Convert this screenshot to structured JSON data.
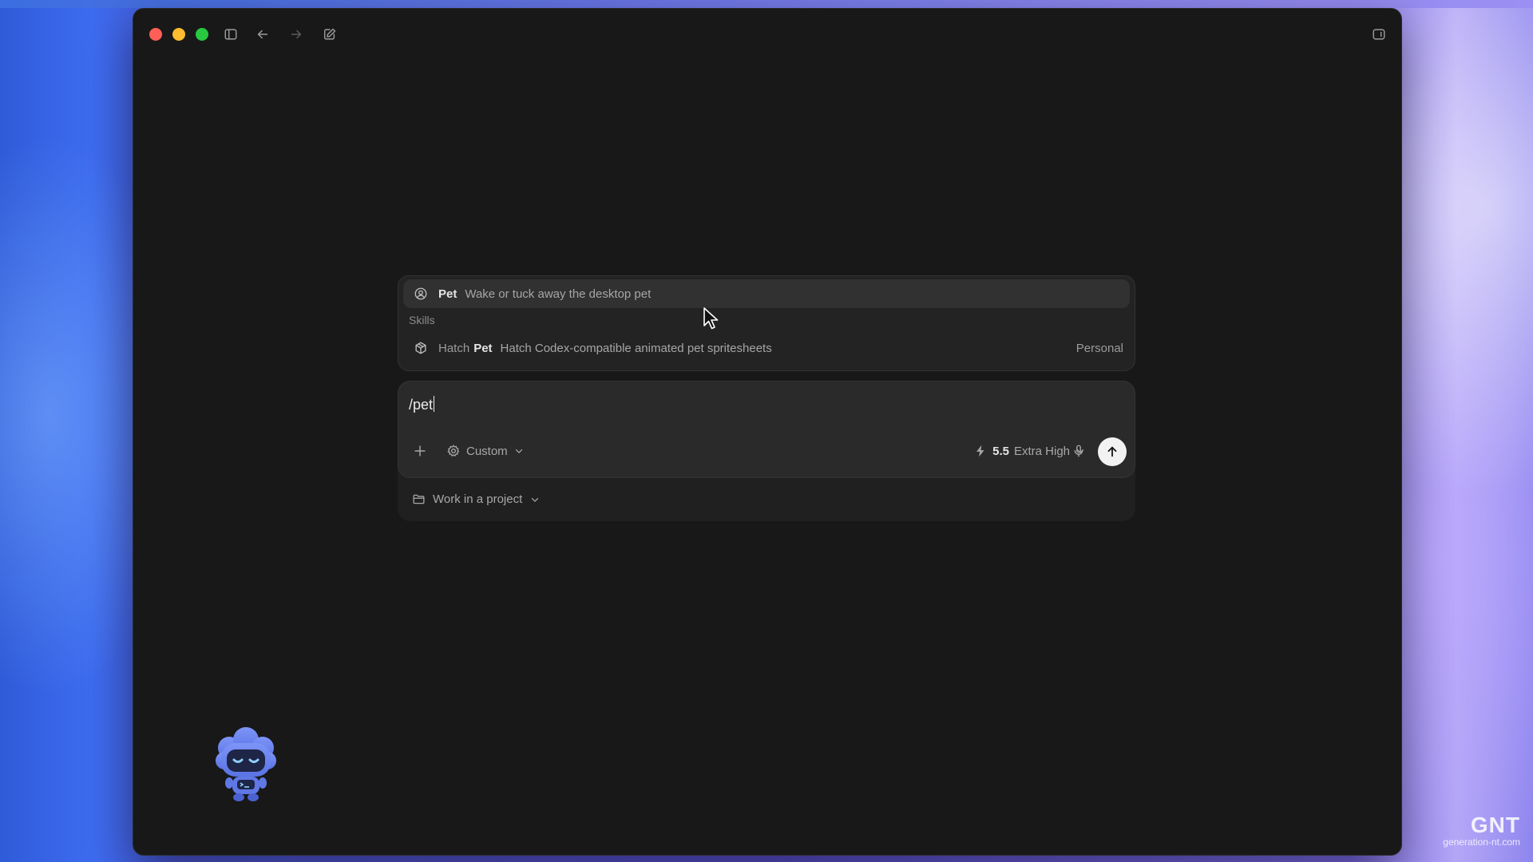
{
  "popup": {
    "command": {
      "name": "Pet",
      "description": "Wake or tuck away the desktop pet",
      "icon": "pet-face-icon"
    },
    "section_label": "Skills",
    "skill": {
      "name_prefix": "Hatch",
      "name": "Pet",
      "description": "Hatch Codex-compatible animated pet spritesheets",
      "tag": "Personal",
      "icon": "cube-icon"
    }
  },
  "composer": {
    "input_value": "/pet",
    "mode_label": "Custom",
    "model_version": "5.5",
    "reasoning_label": "Extra High"
  },
  "project": {
    "label": "Work in a project"
  },
  "watermark": {
    "logo": "GNT",
    "url": "generation-nt.com"
  },
  "colors": {
    "window_bg": "#181818",
    "composer_bg": "#2a2a2a",
    "popup_bg": "#232323",
    "traffic_red": "#ff5f57",
    "traffic_yellow": "#febc2e",
    "traffic_green": "#28c840",
    "pet_blue": "#6b86f0"
  }
}
